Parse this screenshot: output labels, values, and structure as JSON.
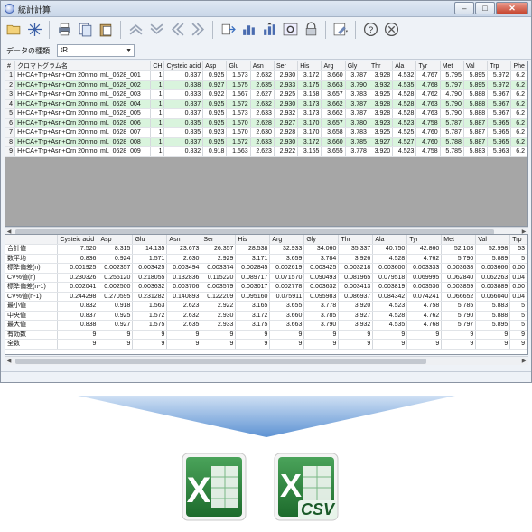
{
  "window": {
    "title": "統計計算",
    "minimize": "–",
    "maximize": "□",
    "close": "✕"
  },
  "toolbar": {
    "icons": [
      "folder-open-icon",
      "sparkle-icon",
      "print-icon",
      "copy-sheet-icon",
      "paste-sheet-icon",
      "up-icon",
      "down-icon",
      "back-double-icon",
      "forward-double-icon",
      "export-icon",
      "chart-icon",
      "chart-up-icon",
      "settings-icon",
      "lock-icon",
      "tools-icon",
      "help-icon",
      "close-circle-icon"
    ]
  },
  "type_selector": {
    "label": "データの種類",
    "value": "tR"
  },
  "chrom_table": {
    "headers": [
      "#",
      "クロマトグラム名",
      "CH",
      "Cysteic acid",
      "Asp",
      "Glu",
      "Asn",
      "Ser",
      "His",
      "Arg",
      "Gly",
      "Thr",
      "Ala",
      "Tyr",
      "Met",
      "Val",
      "Trp",
      "Phe"
    ],
    "rows": [
      [
        "1",
        "H+CA+Trp+Asn+Orn 20nmol mL_0628_001",
        "1",
        "0.837",
        "0.925",
        "1.573",
        "2.632",
        "2.930",
        "3.172",
        "3.660",
        "3.787",
        "3.928",
        "4.532",
        "4.767",
        "5.795",
        "5.895",
        "5.972",
        "6.2"
      ],
      [
        "2",
        "H+CA+Trp+Asn+Orn 20nmol mL_0628_002",
        "1",
        "0.838",
        "0.927",
        "1.575",
        "2.635",
        "2.933",
        "3.175",
        "3.663",
        "3.790",
        "3.932",
        "4.535",
        "4.768",
        "5.797",
        "5.895",
        "5.972",
        "6.2"
      ],
      [
        "3",
        "H+CA+Trp+Asn+Orn 20nmol mL_0628_003",
        "1",
        "0.833",
        "0.922",
        "1.567",
        "2.627",
        "2.925",
        "3.168",
        "3.657",
        "3.783",
        "3.925",
        "4.528",
        "4.762",
        "4.790",
        "5.888",
        "5.967",
        "6.2"
      ],
      [
        "4",
        "H+CA+Trp+Asn+Orn 20nmol mL_0628_004",
        "1",
        "0.837",
        "0.925",
        "1.572",
        "2.632",
        "2.930",
        "3.173",
        "3.662",
        "3.787",
        "3.928",
        "4.528",
        "4.763",
        "5.790",
        "5.888",
        "5.967",
        "6.2"
      ],
      [
        "5",
        "H+CA+Trp+Asn+Orn 20nmol mL_0628_005",
        "1",
        "0.837",
        "0.925",
        "1.573",
        "2.633",
        "2.932",
        "3.173",
        "3.662",
        "3.787",
        "3.928",
        "4.528",
        "4.763",
        "5.790",
        "5.888",
        "5.967",
        "6.2"
      ],
      [
        "6",
        "H+CA+Trp+Asn+Orn 20nmol mL_0628_006",
        "1",
        "0.835",
        "0.925",
        "1.570",
        "2.628",
        "2.927",
        "3.170",
        "3.657",
        "3.780",
        "3.923",
        "4.523",
        "4.758",
        "5.787",
        "5.887",
        "5.965",
        "6.2"
      ],
      [
        "7",
        "H+CA+Trp+Asn+Orn 20nmol mL_0628_007",
        "1",
        "0.835",
        "0.923",
        "1.570",
        "2.630",
        "2.928",
        "3.170",
        "3.658",
        "3.783",
        "3.925",
        "4.525",
        "4.760",
        "5.787",
        "5.887",
        "5.965",
        "6.2"
      ],
      [
        "8",
        "H+CA+Trp+Asn+Orn 20nmol mL_0628_008",
        "1",
        "0.837",
        "0.925",
        "1.572",
        "2.633",
        "2.930",
        "3.172",
        "3.660",
        "3.785",
        "3.927",
        "4.527",
        "4.760",
        "5.788",
        "5.887",
        "5.965",
        "6.2"
      ],
      [
        "9",
        "H+CA+Trp+Asn+Orn 20nmol mL_0628_009",
        "1",
        "0.832",
        "0.918",
        "1.563",
        "2.623",
        "2.922",
        "3.165",
        "3.655",
        "3.778",
        "3.920",
        "4.523",
        "4.758",
        "5.785",
        "5.883",
        "5.963",
        "6.2"
      ]
    ]
  },
  "stats_table": {
    "headers": [
      "",
      "Cysteic acid",
      "Asp",
      "Glu",
      "Asn",
      "Ser",
      "His",
      "Arg",
      "Gly",
      "Thr",
      "Ala",
      "Tyr",
      "Met",
      "Val",
      "Trp"
    ],
    "rows": [
      [
        "合計値",
        "7.520",
        "8.315",
        "14.135",
        "23.673",
        "26.357",
        "28.538",
        "32.933",
        "34.060",
        "35.337",
        "40.750",
        "42.860",
        "52.108",
        "52.998",
        "53"
      ],
      [
        "数平均",
        "0.836",
        "0.924",
        "1.571",
        "2.630",
        "2.929",
        "3.171",
        "3.659",
        "3.784",
        "3.926",
        "4.528",
        "4.762",
        "5.790",
        "5.889",
        "5"
      ],
      [
        "標準偏差(n)",
        "0.001925",
        "0.002357",
        "0.003425",
        "0.003494",
        "0.003374",
        "0.002845",
        "0.002619",
        "0.003425",
        "0.003218",
        "0.003600",
        "0.003333",
        "0.003638",
        "0.003666",
        "0.00"
      ],
      [
        "CV%値(n)",
        "0.230326",
        "0.255120",
        "0.218055",
        "0.132836",
        "0.115220",
        "0.089717",
        "0.071570",
        "0.090493",
        "0.081965",
        "0.079518",
        "0.069995",
        "0.062840",
        "0.062263",
        "0.04"
      ],
      [
        "標準偏差(n-1)",
        "0.002041",
        "0.002500",
        "0.003632",
        "0.003706",
        "0.003579",
        "0.003017",
        "0.002778",
        "0.003632",
        "0.003413",
        "0.003819",
        "0.003536",
        "0.003859",
        "0.003889",
        "0.00"
      ],
      [
        "CV%値(n-1)",
        "0.244298",
        "0.270595",
        "0.231282",
        "0.140893",
        "0.122209",
        "0.095160",
        "0.075911",
        "0.095983",
        "0.086937",
        "0.084342",
        "0.074241",
        "0.066652",
        "0.066040",
        "0.04"
      ],
      [
        "最小値",
        "0.832",
        "0.918",
        "1.563",
        "2.623",
        "2.922",
        "3.165",
        "3.655",
        "3.778",
        "3.920",
        "4.523",
        "4.758",
        "5.785",
        "5.883",
        "5"
      ],
      [
        "中央値",
        "0.837",
        "0.925",
        "1.572",
        "2.632",
        "2.930",
        "3.172",
        "3.660",
        "3.785",
        "3.927",
        "4.528",
        "4.762",
        "5.790",
        "5.888",
        "5"
      ],
      [
        "最大値",
        "0.838",
        "0.927",
        "1.575",
        "2.635",
        "2.933",
        "3.175",
        "3.663",
        "3.790",
        "3.932",
        "4.535",
        "4.768",
        "5.797",
        "5.895",
        "5"
      ],
      [
        "有効数",
        "9",
        "9",
        "9",
        "9",
        "9",
        "9",
        "9",
        "9",
        "9",
        "9",
        "9",
        "9",
        "9",
        "9"
      ],
      [
        "全数",
        "9",
        "9",
        "9",
        "9",
        "9",
        "9",
        "9",
        "9",
        "9",
        "9",
        "9",
        "9",
        "9",
        "9"
      ]
    ]
  },
  "exports": {
    "excel_icon": "excel-icon",
    "csv_icon": "excel-csv-icon",
    "csv_text": "CSV"
  },
  "colors": {
    "row_highlight": "#d9f4dd",
    "excel_green": "#2f8a3f",
    "arrow_blue": "#6b9fd8"
  }
}
